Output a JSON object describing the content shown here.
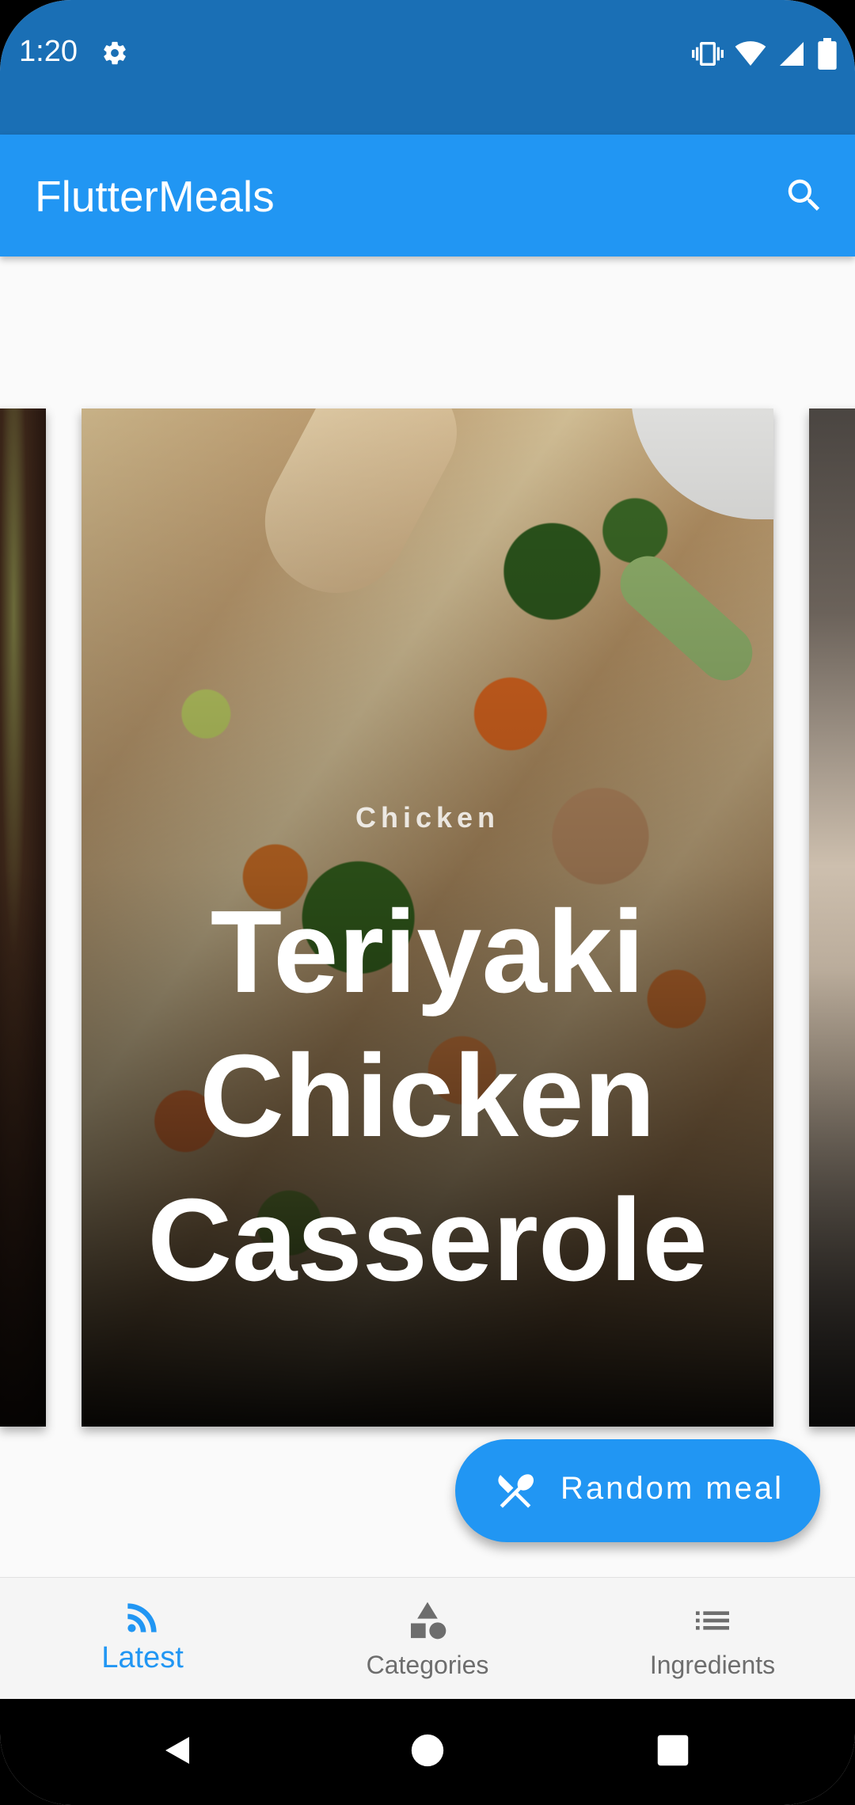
{
  "status_bar": {
    "time": "1:20",
    "icons": [
      "settings-icon",
      "vibrate-icon",
      "wifi-icon",
      "signal-icon",
      "battery-icon"
    ]
  },
  "app_bar": {
    "title": "FlutterMeals",
    "search_icon": "search-icon"
  },
  "carousel": {
    "current": {
      "category": "Chicken",
      "title_lines": [
        "Teriyaki",
        "Chicken",
        "Casserole"
      ]
    }
  },
  "fab": {
    "label": "Random meal",
    "icon": "utensils-icon"
  },
  "bottom_nav": {
    "items": [
      {
        "label": "Latest",
        "icon": "rss-feed-icon",
        "active": true
      },
      {
        "label": "Categories",
        "icon": "category-shapes-icon",
        "active": false
      },
      {
        "label": "Ingredients",
        "icon": "list-icon",
        "active": false
      }
    ]
  },
  "system_nav": {
    "buttons": [
      "back-icon",
      "home-icon",
      "recents-icon"
    ]
  },
  "colors": {
    "primary": "#2196f3",
    "status_bar": "#1a6fb5",
    "active_nav": "#2196f3",
    "inactive_nav": "#6d6d6d"
  }
}
